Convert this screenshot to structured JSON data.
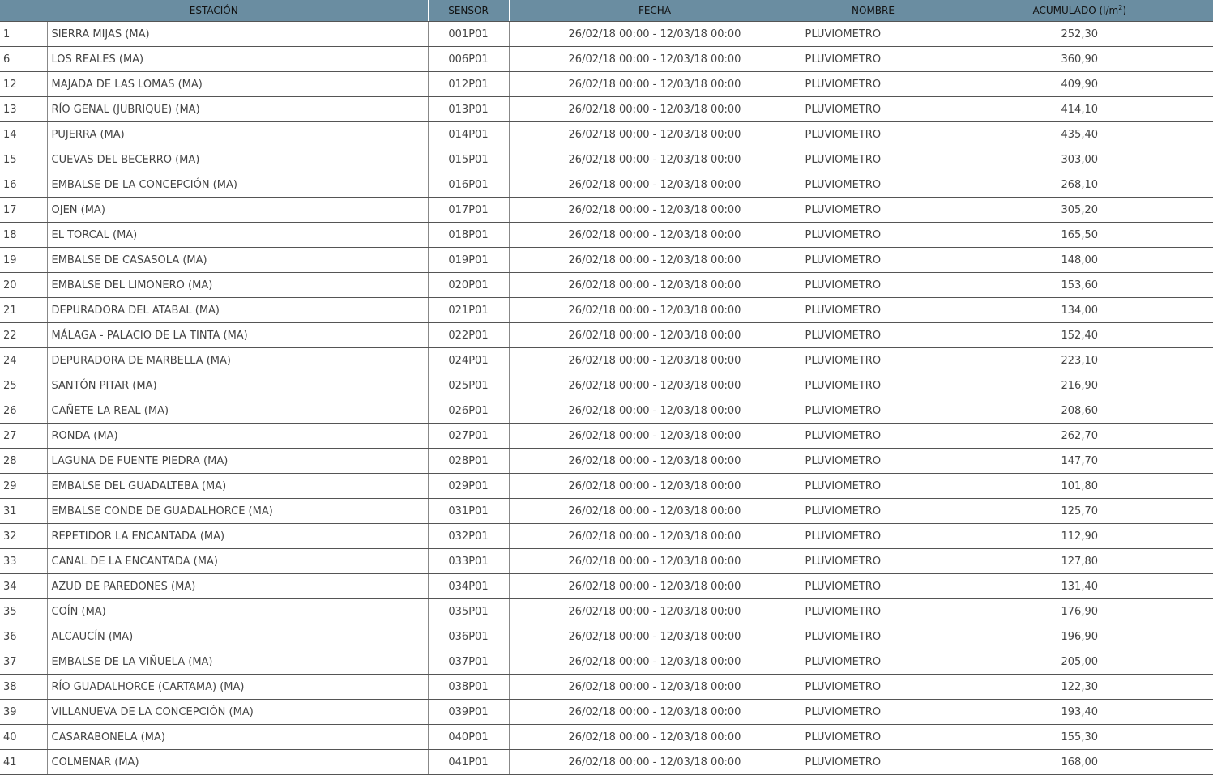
{
  "table": {
    "headers": {
      "estacion": "ESTACIÓN",
      "sensor": "SENSOR",
      "fecha": "FECHA",
      "nombre": "NOMBRE",
      "acumulado": "ACUMULADO (l/m",
      "acumulado_sup": "2",
      "acumulado_close": ")"
    },
    "rows": [
      {
        "num": "1",
        "estacion": "SIERRA MIJAS (MA)",
        "sensor": "001P01",
        "fecha": "26/02/18 00:00 - 12/03/18 00:00",
        "nombre": "PLUVIOMETRO",
        "acumulado": "252,30"
      },
      {
        "num": "6",
        "estacion": "LOS REALES (MA)",
        "sensor": "006P01",
        "fecha": "26/02/18 00:00 - 12/03/18 00:00",
        "nombre": "PLUVIOMETRO",
        "acumulado": "360,90"
      },
      {
        "num": "12",
        "estacion": "MAJADA DE LAS LOMAS (MA)",
        "sensor": "012P01",
        "fecha": "26/02/18 00:00 - 12/03/18 00:00",
        "nombre": "PLUVIOMETRO",
        "acumulado": "409,90"
      },
      {
        "num": "13",
        "estacion": "RÍO GENAL (JUBRIQUE) (MA)",
        "sensor": "013P01",
        "fecha": "26/02/18 00:00 - 12/03/18 00:00",
        "nombre": "PLUVIOMETRO",
        "acumulado": "414,10"
      },
      {
        "num": "14",
        "estacion": "PUJERRA (MA)",
        "sensor": "014P01",
        "fecha": "26/02/18 00:00 - 12/03/18 00:00",
        "nombre": "PLUVIOMETRO",
        "acumulado": "435,40"
      },
      {
        "num": "15",
        "estacion": "CUEVAS DEL BECERRO (MA)",
        "sensor": "015P01",
        "fecha": "26/02/18 00:00 - 12/03/18 00:00",
        "nombre": "PLUVIOMETRO",
        "acumulado": "303,00"
      },
      {
        "num": "16",
        "estacion": "EMBALSE DE LA CONCEPCIÓN (MA)",
        "sensor": "016P01",
        "fecha": "26/02/18 00:00 - 12/03/18 00:00",
        "nombre": "PLUVIOMETRO",
        "acumulado": "268,10"
      },
      {
        "num": "17",
        "estacion": "OJEN (MA)",
        "sensor": "017P01",
        "fecha": "26/02/18 00:00 - 12/03/18 00:00",
        "nombre": "PLUVIOMETRO",
        "acumulado": "305,20"
      },
      {
        "num": "18",
        "estacion": "EL TORCAL (MA)",
        "sensor": "018P01",
        "fecha": "26/02/18 00:00 - 12/03/18 00:00",
        "nombre": "PLUVIOMETRO",
        "acumulado": "165,50"
      },
      {
        "num": "19",
        "estacion": "EMBALSE DE CASASOLA (MA)",
        "sensor": "019P01",
        "fecha": "26/02/18 00:00 - 12/03/18 00:00",
        "nombre": "PLUVIOMETRO",
        "acumulado": "148,00"
      },
      {
        "num": "20",
        "estacion": "EMBALSE DEL LIMONERO (MA)",
        "sensor": "020P01",
        "fecha": "26/02/18 00:00 - 12/03/18 00:00",
        "nombre": "PLUVIOMETRO",
        "acumulado": "153,60"
      },
      {
        "num": "21",
        "estacion": "DEPURADORA DEL ATABAL (MA)",
        "sensor": "021P01",
        "fecha": "26/02/18 00:00 - 12/03/18 00:00",
        "nombre": "PLUVIOMETRO",
        "acumulado": "134,00"
      },
      {
        "num": "22",
        "estacion": "MÁLAGA - PALACIO DE LA TINTA (MA)",
        "sensor": "022P01",
        "fecha": "26/02/18 00:00 - 12/03/18 00:00",
        "nombre": "PLUVIOMETRO",
        "acumulado": "152,40"
      },
      {
        "num": "24",
        "estacion": "DEPURADORA DE MARBELLA (MA)",
        "sensor": "024P01",
        "fecha": "26/02/18 00:00 - 12/03/18 00:00",
        "nombre": "PLUVIOMETRO",
        "acumulado": "223,10"
      },
      {
        "num": "25",
        "estacion": "SANTÓN PITAR (MA)",
        "sensor": "025P01",
        "fecha": "26/02/18 00:00 - 12/03/18 00:00",
        "nombre": "PLUVIOMETRO",
        "acumulado": "216,90"
      },
      {
        "num": "26",
        "estacion": "CAÑETE LA REAL (MA)",
        "sensor": "026P01",
        "fecha": "26/02/18 00:00 - 12/03/18 00:00",
        "nombre": "PLUVIOMETRO",
        "acumulado": "208,60"
      },
      {
        "num": "27",
        "estacion": "RONDA (MA)",
        "sensor": "027P01",
        "fecha": "26/02/18 00:00 - 12/03/18 00:00",
        "nombre": "PLUVIOMETRO",
        "acumulado": "262,70"
      },
      {
        "num": "28",
        "estacion": "LAGUNA DE FUENTE PIEDRA (MA)",
        "sensor": "028P01",
        "fecha": "26/02/18 00:00 - 12/03/18 00:00",
        "nombre": "PLUVIOMETRO",
        "acumulado": "147,70"
      },
      {
        "num": "29",
        "estacion": "EMBALSE DEL GUADALTEBA (MA)",
        "sensor": "029P01",
        "fecha": "26/02/18 00:00 - 12/03/18 00:00",
        "nombre": "PLUVIOMETRO",
        "acumulado": "101,80"
      },
      {
        "num": "31",
        "estacion": "EMBALSE CONDE DE GUADALHORCE (MA)",
        "sensor": "031P01",
        "fecha": "26/02/18 00:00 - 12/03/18 00:00",
        "nombre": "PLUVIOMETRO",
        "acumulado": "125,70"
      },
      {
        "num": "32",
        "estacion": "REPETIDOR LA ENCANTADA (MA)",
        "sensor": "032P01",
        "fecha": "26/02/18 00:00 - 12/03/18 00:00",
        "nombre": "PLUVIOMETRO",
        "acumulado": "112,90"
      },
      {
        "num": "33",
        "estacion": "CANAL DE LA ENCANTADA (MA)",
        "sensor": "033P01",
        "fecha": "26/02/18 00:00 - 12/03/18 00:00",
        "nombre": "PLUVIOMETRO",
        "acumulado": "127,80"
      },
      {
        "num": "34",
        "estacion": "AZUD DE PAREDONES (MA)",
        "sensor": "034P01",
        "fecha": "26/02/18 00:00 - 12/03/18 00:00",
        "nombre": "PLUVIOMETRO",
        "acumulado": "131,40"
      },
      {
        "num": "35",
        "estacion": "COÍN (MA)",
        "sensor": "035P01",
        "fecha": "26/02/18 00:00 - 12/03/18 00:00",
        "nombre": "PLUVIOMETRO",
        "acumulado": "176,90"
      },
      {
        "num": "36",
        "estacion": "ALCAUCÍN (MA)",
        "sensor": "036P01",
        "fecha": "26/02/18 00:00 - 12/03/18 00:00",
        "nombre": "PLUVIOMETRO",
        "acumulado": "196,90"
      },
      {
        "num": "37",
        "estacion": "EMBALSE DE LA VIÑUELA (MA)",
        "sensor": "037P01",
        "fecha": "26/02/18 00:00 - 12/03/18 00:00",
        "nombre": "PLUVIOMETRO",
        "acumulado": "205,00"
      },
      {
        "num": "38",
        "estacion": "RÍO GUADALHORCE (CARTAMA) (MA)",
        "sensor": "038P01",
        "fecha": "26/02/18 00:00 - 12/03/18 00:00",
        "nombre": "PLUVIOMETRO",
        "acumulado": "122,30"
      },
      {
        "num": "39",
        "estacion": "VILLANUEVA DE LA CONCEPCIÓN (MA)",
        "sensor": "039P01",
        "fecha": "26/02/18 00:00 - 12/03/18 00:00",
        "nombre": "PLUVIOMETRO",
        "acumulado": "193,40"
      },
      {
        "num": "40",
        "estacion": "CASARABONELA (MA)",
        "sensor": "040P01",
        "fecha": "26/02/18 00:00 - 12/03/18 00:00",
        "nombre": "PLUVIOMETRO",
        "acumulado": "155,30"
      },
      {
        "num": "41",
        "estacion": "COLMENAR (MA)",
        "sensor": "041P01",
        "fecha": "26/02/18 00:00 - 12/03/18 00:00",
        "nombre": "PLUVIOMETRO",
        "acumulado": "168,00"
      }
    ]
  }
}
